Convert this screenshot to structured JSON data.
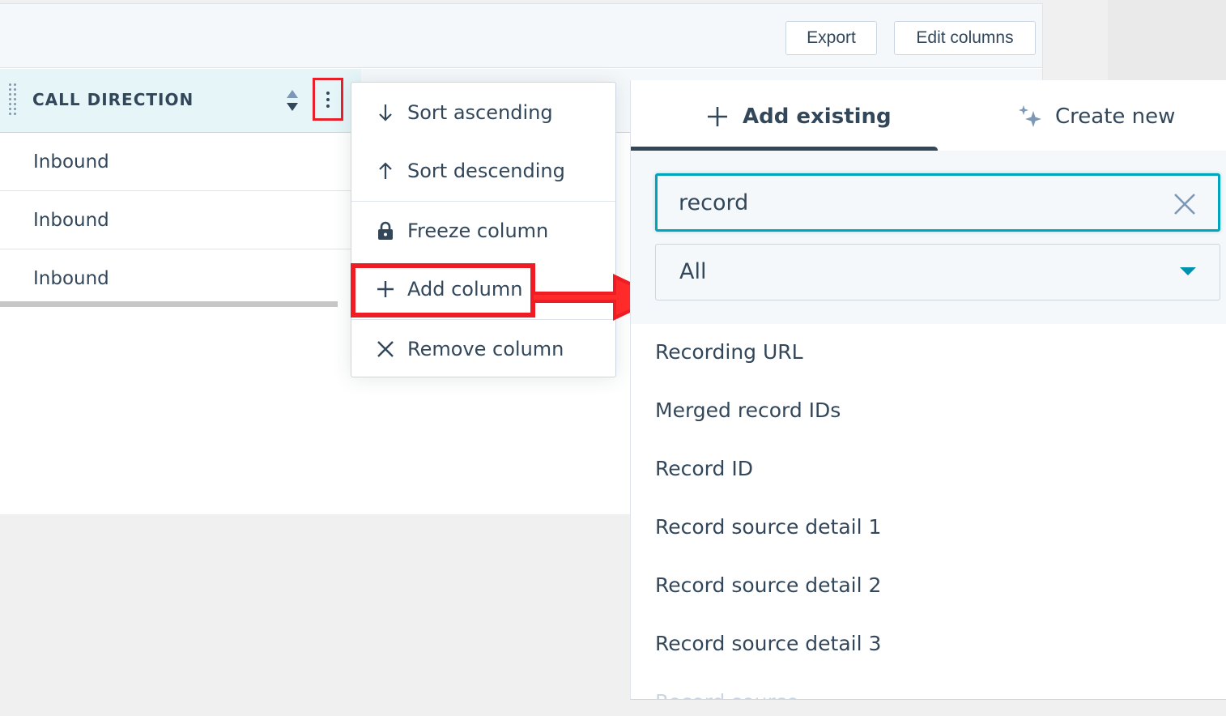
{
  "toolbar": {
    "export_label": "Export",
    "edit_columns_label": "Edit columns"
  },
  "column": {
    "title": "CALL DIRECTION",
    "rows": [
      "Inbound",
      "Inbound",
      "Inbound"
    ]
  },
  "menu": {
    "items": [
      {
        "label": "Sort ascending",
        "icon": "arrow-down-icon"
      },
      {
        "label": "Sort descending",
        "icon": "arrow-up-icon"
      },
      {
        "label": "Freeze column",
        "icon": "lock-icon"
      },
      {
        "label": "Add column",
        "icon": "plus-icon"
      },
      {
        "label": "Remove column",
        "icon": "close-icon"
      }
    ]
  },
  "panel": {
    "tabs": [
      {
        "label": "Add existing",
        "icon": "plus-icon",
        "active": true
      },
      {
        "label": "Create new",
        "icon": "sparkle-icon",
        "active": false
      }
    ],
    "search_value": "record",
    "filter_value": "All",
    "results": [
      "Recording URL",
      "Merged record IDs",
      "Record ID",
      "Record source detail 1",
      "Record source detail 2",
      "Record source detail 3",
      "Record source"
    ]
  },
  "colors": {
    "highlight": "#ee1c24",
    "accent": "#00a4bd",
    "text": "#33475b"
  }
}
